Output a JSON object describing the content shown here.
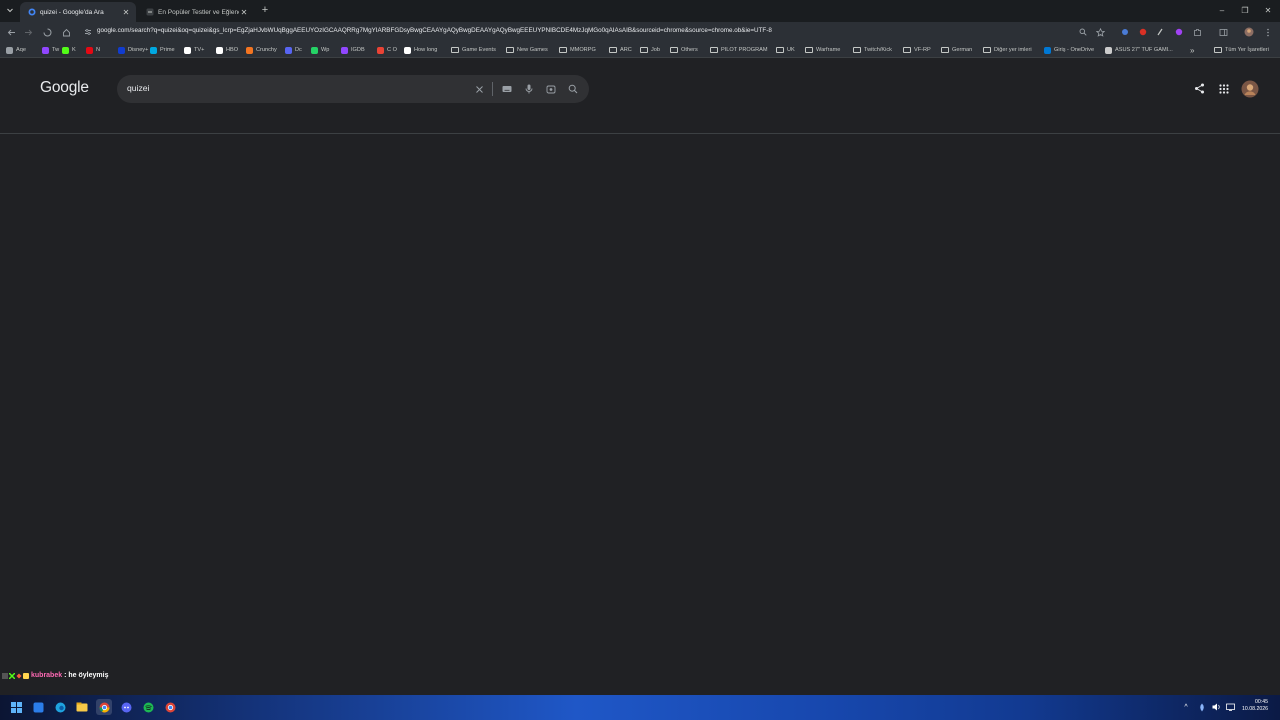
{
  "tabs": [
    {
      "title": "quizei - Google'da Ara",
      "active": true
    },
    {
      "title": "En Popüler Testler ve Eğlenceli",
      "active": false
    }
  ],
  "window_controls": {
    "minimize": "–",
    "restore": "❐",
    "close": "✕"
  },
  "address_bar": {
    "url": "google.com/search?q=quizei&oq=quizei&gs_lcrp=EgZjaHJvbWUqBggAEEUYOzIGCAAQRRg7MgYIARBFGDsyBwgCEAAYgAQyBwgDEAAYgAQyBwgEEEUYPNIBCDE4MzJqMGo0qAIAsAIB&sourceid=chrome&source=chrome.ob&ie=UTF-8"
  },
  "bookmarks": [
    {
      "label": "Aqe",
      "color": "#9aa0a6"
    },
    {
      "label": "Tw",
      "color": "#9146ff"
    },
    {
      "label": "K",
      "color": "#53fc18"
    },
    {
      "label": "N",
      "color": "#e50914"
    },
    {
      "label": "Disney+",
      "color": "#113ccf"
    },
    {
      "label": "Prime",
      "color": "#00a8e1"
    },
    {
      "label": "TV+",
      "color": "#ffffff"
    },
    {
      "label": "HBO",
      "color": "#ffffff"
    },
    {
      "label": "Crunchy",
      "color": "#f47521"
    },
    {
      "label": "Dc",
      "color": "#5865f2"
    },
    {
      "label": "Wp",
      "color": "#25d366"
    },
    {
      "label": "IGDB",
      "color": "#9147ff"
    },
    {
      "label": "C O",
      "color": "#ea4335"
    },
    {
      "label": "How long",
      "color": "#ffffff"
    },
    {
      "label": "Game Events",
      "folder": true
    },
    {
      "label": "New Games",
      "folder": true
    },
    {
      "label": "MMORPG",
      "folder": true
    },
    {
      "label": "ARC",
      "folder": true
    },
    {
      "label": "Job",
      "folder": true
    },
    {
      "label": "Others",
      "folder": true
    },
    {
      "label": "PILOT PROGRAM",
      "folder": true
    },
    {
      "label": "UK",
      "folder": true
    },
    {
      "label": "Warframe",
      "folder": true
    },
    {
      "label": "Twitch/Kick",
      "folder": true
    },
    {
      "label": "VF-RP",
      "folder": true
    },
    {
      "label": "German",
      "folder": true
    },
    {
      "label": "Diğer yer imleri",
      "folder": true
    },
    {
      "label": "Giriş - OneDrive",
      "color": "#0078d4"
    },
    {
      "label": "ASUS 27\" TUF GAMI...",
      "color": "#cccccc"
    }
  ],
  "bookmarks_overflow": "»",
  "all_bookmarks": "Tüm Yer İşaretleri",
  "google": {
    "logo": "Google",
    "query": "quizei"
  },
  "chat": {
    "user": "kubrabek",
    "message": ": he öyleymiş"
  },
  "clock": {
    "time": "00:45",
    "date": "10.08.2026"
  }
}
